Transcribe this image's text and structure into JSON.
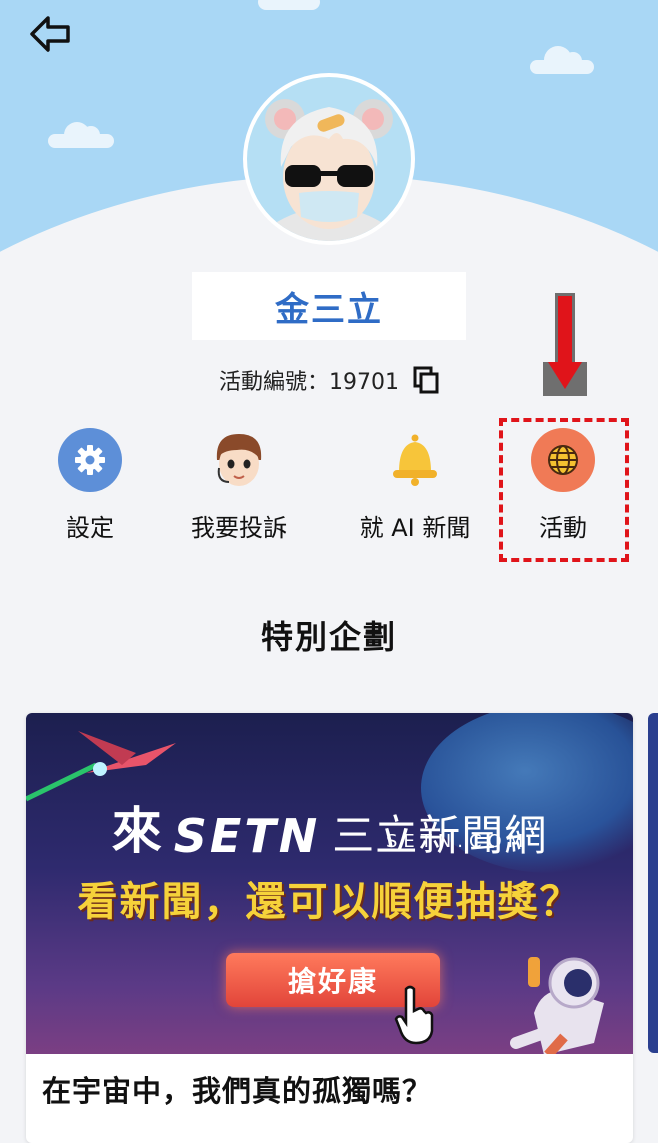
{
  "profile": {
    "name": "金三立",
    "member_id_label": "活動編號：19701"
  },
  "actions": [
    {
      "label": "設定",
      "icon": "gear-icon"
    },
    {
      "label": "我要投訴",
      "icon": "complaint-avatar-icon"
    },
    {
      "label": "就 AI 新聞",
      "icon": "bell-icon"
    },
    {
      "label": "活動",
      "icon": "globe-icon"
    }
  ],
  "section": {
    "title": "特別企劃"
  },
  "card": {
    "banner_brand_lai": "來",
    "banner_brand_setn": "SETN",
    "banner_brand_cn": "三立新聞網",
    "banner_domain": "SETN.COM",
    "banner_slogan": "看新聞，還可以順便抽獎？",
    "banner_button": "搶好康",
    "title": "在宇宙中，我們真的孤獨嗎？"
  },
  "colors": {
    "accent_blue": "#2f6cc6",
    "highlight_red": "#e0141a",
    "sky": "#a9d7f5",
    "slogan_yellow": "#f6d23a"
  }
}
